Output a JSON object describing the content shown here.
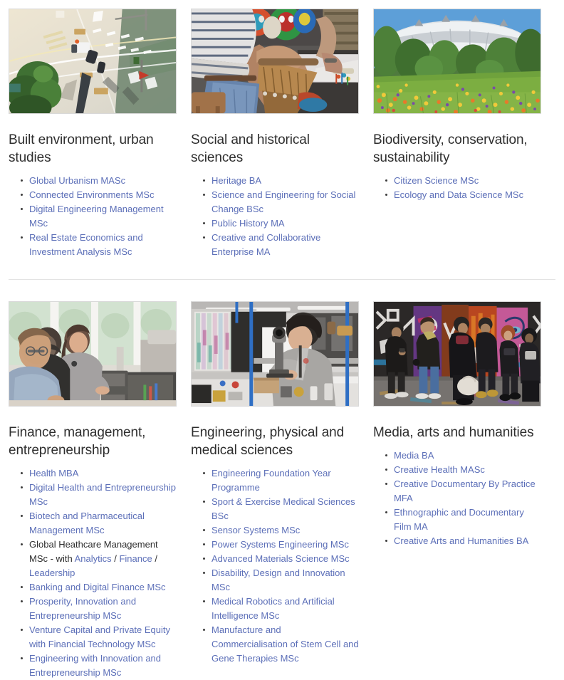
{
  "page": {
    "background_color": "#ffffff",
    "link_color": "#5c6fb8",
    "heading_color": "#2e2e2e",
    "divider_color": "#e3e3e3"
  },
  "rows": [
    {
      "cards": [
        {
          "image_name": "aerial-road-intersection-photo",
          "image_alt": "Aerial view of a road intersection with white lane markings and a tree",
          "title": "Built environment, urban studies",
          "links": [
            "Global Urbanism MASc",
            "Connected Environments MSc",
            "Digital Engineering Management MSc",
            "Real Estate Economics and Investment Analysis MSc"
          ]
        },
        {
          "image_name": "drumming-workshop-photo",
          "image_alt": "Person in a striped shirt playing a djembe drum with colourful masks behind",
          "title": "Social and historical sciences",
          "links": [
            "Heritage BA",
            "Science and Engineering for Social Change BSc",
            "Public History MA",
            "Creative and Collaborative Enterprise MA"
          ]
        },
        {
          "image_name": "olympic-stadium-wildflower-meadow-photo",
          "image_alt": "Olympic stadium behind trees with a wildflower meadow in the foreground",
          "title": "Biodiversity, conservation, sustainability",
          "links": [
            "Citizen Science MSc",
            "Ecology and Data Science MSc"
          ]
        }
      ]
    },
    {
      "cards": [
        {
          "image_name": "office-workers-at-computers-photo",
          "image_alt": "Students and staff working at computers in a bright office",
          "title": "Finance, management, entrepreneurship",
          "links": [
            "Health MBA",
            "Digital Health and Entrepreneurship MSc",
            "Biotech and Pharmaceutical Management MSc",
            "Banking and Digital Finance MSc",
            "Prosperity, Innovation and Entrepreneurship MSc",
            "Venture Capital and Private Equity with Financial Technology MSc",
            "Engineering with Innovation and Entrepreneurship MSc"
          ],
          "mixed_item": {
            "position": 3,
            "prefix": "Global Heathcare Management MSc - with ",
            "options": [
              "Analytics",
              "Finance",
              "Leadership"
            ],
            "separator": " / "
          }
        },
        {
          "image_name": "laboratory-microscope-researcher-photo",
          "image_alt": "Researcher looking through a microscope in a laboratory with blue pipes",
          "title": "Engineering, physical and medical sciences",
          "links": [
            "Engineering Foundation Year Programme",
            "Sport & Exercise Medical Sciences BSc",
            "Sensor Systems MSc",
            "Power Systems Engineering MSc",
            "Advanced Materials Science MSc",
            "Disability, Design and Innovation MSc",
            "Medical Robotics and Artificial Intelligence MSc",
            "Manufacture and Commercialisation of Stem Cell and Gene Therapies MSc"
          ]
        },
        {
          "image_name": "graffiti-wall-street-scene-photo",
          "image_alt": "People standing in front of a graffiti-covered wall on a street",
          "title": "Media, arts and humanities",
          "links": [
            "Media BA",
            "Creative Health MASc",
            "Creative Documentary By Practice MFA",
            "Ethnographic and Documentary Film MA",
            "Creative Arts and Humanities BA"
          ]
        }
      ]
    }
  ]
}
